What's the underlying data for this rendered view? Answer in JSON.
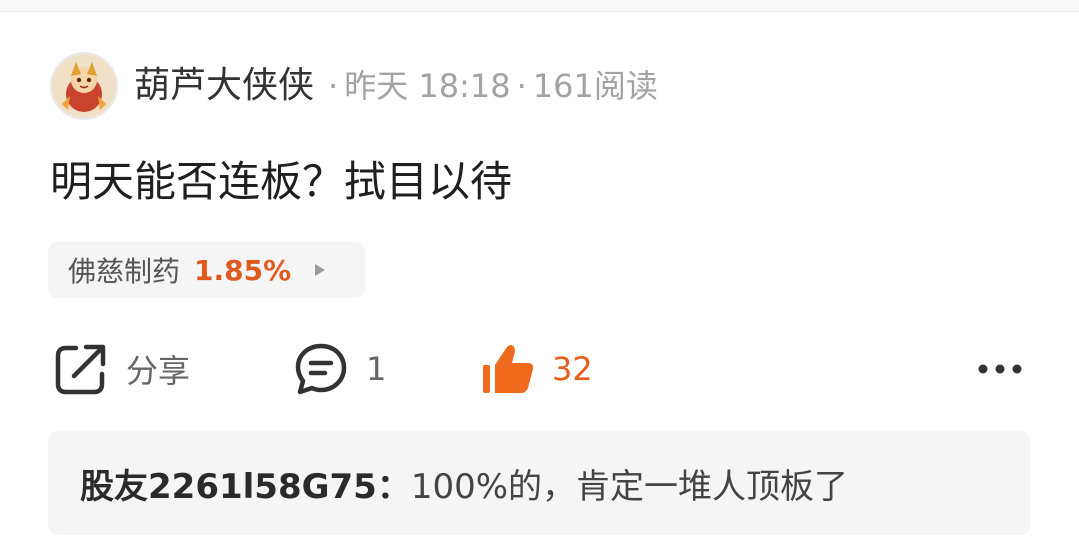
{
  "post": {
    "author": {
      "name": "葫芦大侠侠",
      "avatar_icon": "avatar-image"
    },
    "meta": {
      "separator": "·",
      "time": "昨天 18:18",
      "reads": "161阅读"
    },
    "content": "明天能否连板？拭目以待",
    "stock_tag": {
      "name": "佛慈制药",
      "change": "1.85%",
      "change_color": "#e05a1e",
      "arrow_icon": "triangle-right-icon"
    }
  },
  "actions": {
    "share": {
      "icon": "share-icon",
      "label": "分享"
    },
    "comment": {
      "icon": "comment-icon",
      "count": "1"
    },
    "like": {
      "icon": "thumbs-up-icon",
      "count": "32",
      "color": "#e85d1a"
    },
    "more": {
      "icon": "more-icon"
    }
  },
  "reply": {
    "user": "股友2261l58G75",
    "colon": "：",
    "text": "100%的，肯定一堆人顶板了"
  }
}
